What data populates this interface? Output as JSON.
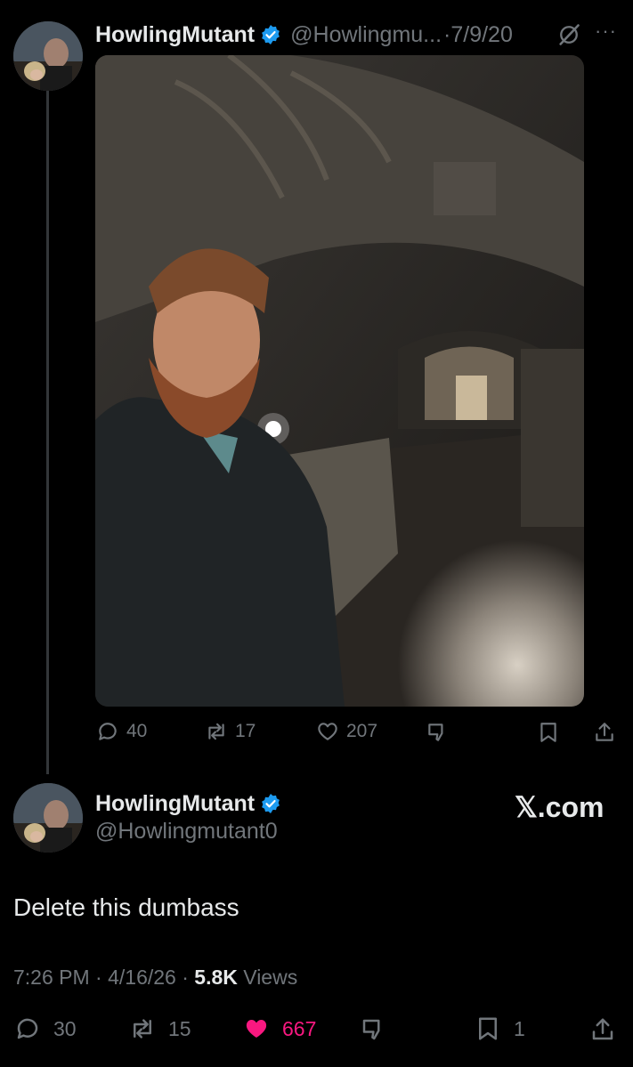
{
  "quoted": {
    "display_name": "HowlingMutant",
    "handle": "@Howlingmu...",
    "date": "·7/9/20",
    "more": "···",
    "actions": {
      "replies": "40",
      "reposts": "17",
      "likes": "207"
    }
  },
  "reply": {
    "display_name": "HowlingMutant",
    "handle": "@Howlingmutant0",
    "brand": "𝕏.com",
    "text": "Delete this dumbass",
    "time": "7:26 PM · 4/16/26 · ",
    "views_count": "5.8K",
    "views_label": " Views",
    "actions": {
      "replies": "30",
      "reposts": "15",
      "likes": "667",
      "bookmarks": "1"
    }
  },
  "colors": {
    "background": "#000000",
    "text": "#e7e9ea",
    "muted": "#71767b",
    "verified": "#1d9bf0",
    "like_active": "#f91880"
  }
}
